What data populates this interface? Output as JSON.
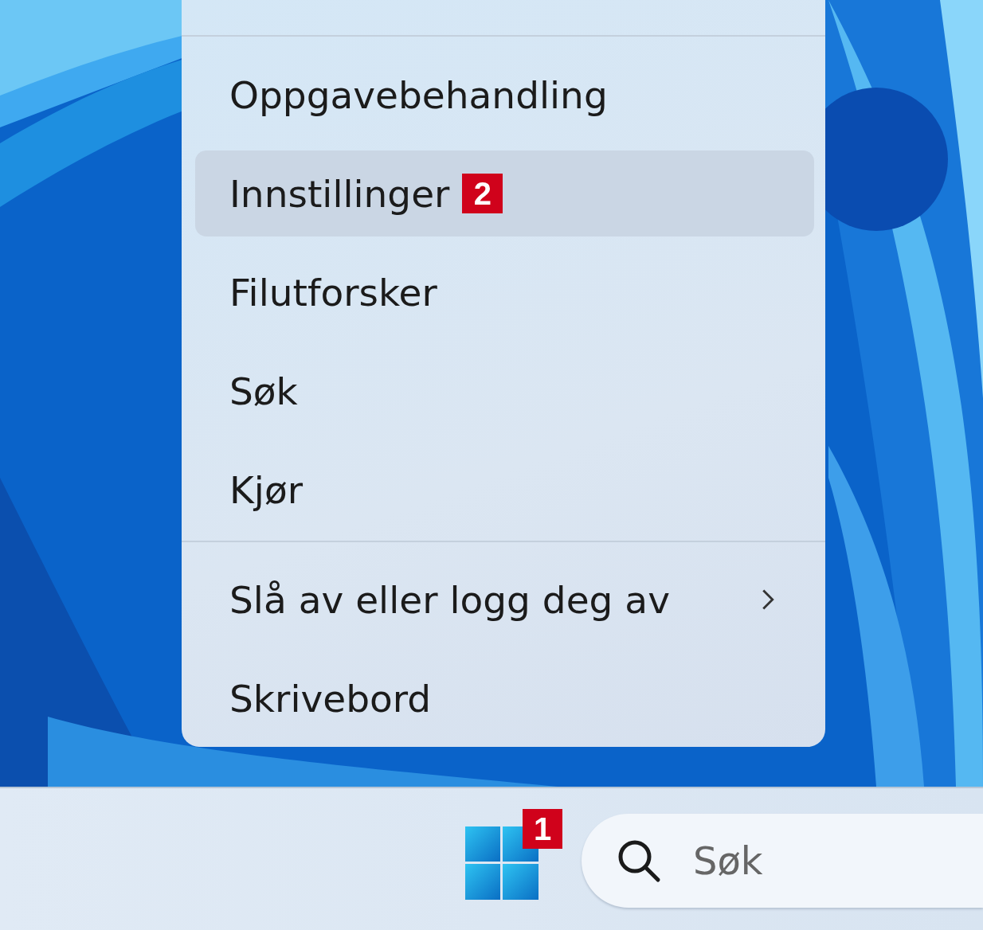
{
  "menu": {
    "items": [
      {
        "kind": "separator"
      },
      {
        "kind": "item",
        "label": "Oppgavebehandling",
        "selected": false
      },
      {
        "kind": "item",
        "label": "Innstillinger",
        "selected": true,
        "badge": "2"
      },
      {
        "kind": "item",
        "label": "Filutforsker",
        "selected": false
      },
      {
        "kind": "item",
        "label": "Søk",
        "selected": false
      },
      {
        "kind": "item",
        "label": "Kjør",
        "selected": false
      },
      {
        "kind": "separator"
      },
      {
        "kind": "submenu",
        "label": "Slå av eller logg deg av",
        "selected": false
      },
      {
        "kind": "item",
        "label": "Skrivebord",
        "selected": false
      }
    ]
  },
  "taskbar": {
    "start_badge": "1",
    "search": {
      "placeholder": "Søk"
    }
  }
}
